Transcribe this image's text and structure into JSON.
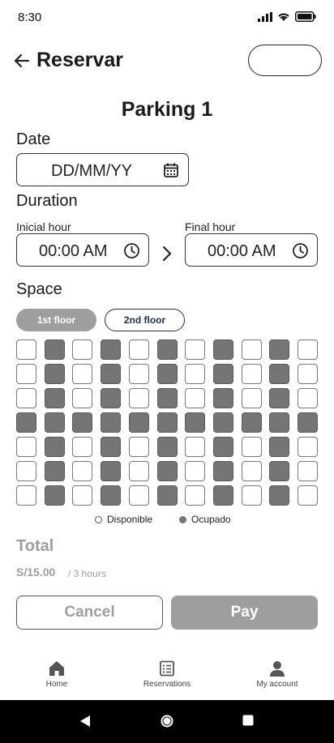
{
  "status_bar": {
    "time": "8:30"
  },
  "header": {
    "title": "Reservar"
  },
  "parking": {
    "name": "Parking 1"
  },
  "date": {
    "label": "Date",
    "placeholder": "DD/MM/YY",
    "icon": "calendar-icon"
  },
  "duration": {
    "label": "Duration",
    "initial_label": "Inicial hour",
    "initial_value": "00:00 AM",
    "final_label": "Final hour",
    "final_value": "00:00 AM",
    "clock_icon": "clock-icon",
    "arrow_icon": "chevron-right-icon"
  },
  "space": {
    "label": "Space",
    "floors": [
      {
        "label": "1st floor",
        "active": true
      },
      {
        "label": "2nd floor",
        "active": false
      }
    ],
    "grid": [
      [
        0,
        1,
        0,
        1,
        0,
        1,
        0,
        1,
        0,
        1,
        0
      ],
      [
        0,
        1,
        0,
        1,
        0,
        1,
        0,
        1,
        0,
        1,
        0
      ],
      [
        0,
        1,
        0,
        1,
        0,
        1,
        0,
        1,
        0,
        1,
        0
      ],
      [
        1,
        1,
        1,
        1,
        1,
        1,
        1,
        1,
        1,
        1,
        1
      ],
      [
        0,
        1,
        0,
        1,
        0,
        1,
        0,
        1,
        0,
        1,
        0
      ],
      [
        0,
        1,
        0,
        1,
        0,
        1,
        0,
        1,
        0,
        1,
        0
      ],
      [
        0,
        1,
        0,
        1,
        0,
        1,
        0,
        1,
        0,
        1,
        0
      ]
    ],
    "legend_free": "Disponible",
    "legend_busy": "Ocupado",
    "colors": {
      "free": "#ffffff",
      "busy": "#757575"
    }
  },
  "total": {
    "label": "Total",
    "price": "S/15.00",
    "unit": "/ 3 hours"
  },
  "actions": {
    "cancel": "Cancel",
    "pay": "Pay"
  },
  "nav": [
    {
      "label": "Home",
      "icon": "home-icon"
    },
    {
      "label": "Reservations",
      "icon": "list-icon"
    },
    {
      "label": "My account",
      "icon": "user-icon"
    }
  ],
  "system_nav": {
    "back_icon": "back-triangle-icon",
    "home_icon": "home-circle-icon",
    "recents_icon": "recents-square-icon"
  }
}
